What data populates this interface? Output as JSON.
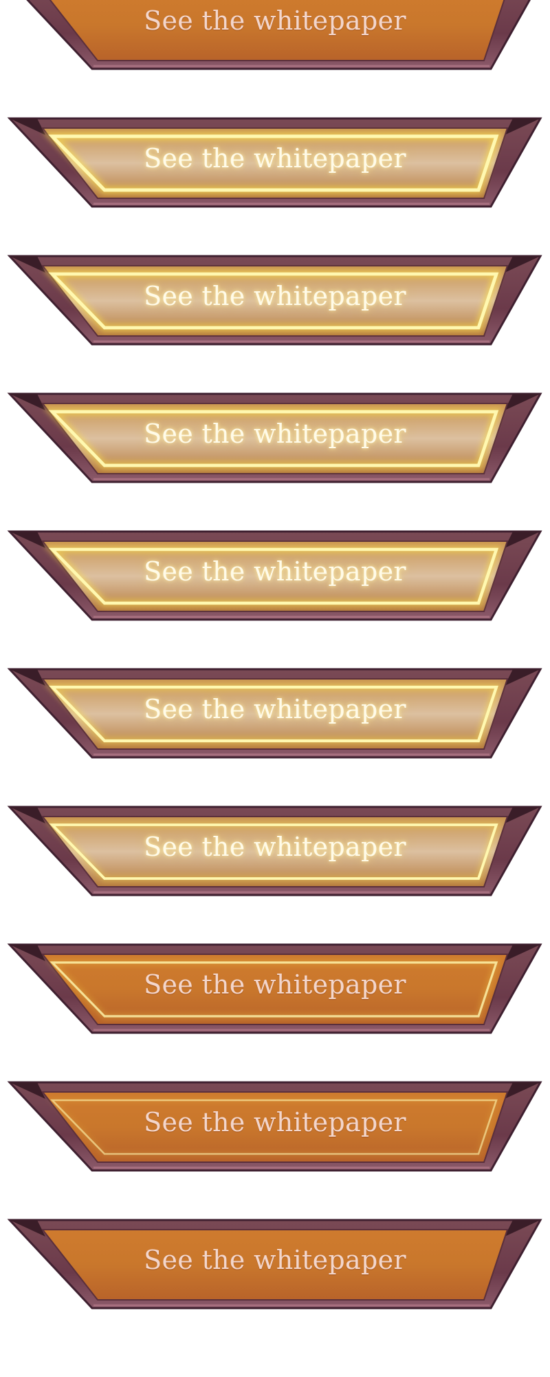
{
  "button_label": "See the whitepaper",
  "frames": [
    {
      "state": "idle",
      "glow_level": 0
    },
    {
      "state": "hover",
      "glow_level": 1
    },
    {
      "state": "hover",
      "glow_level": 0.95
    },
    {
      "state": "hover",
      "glow_level": 0.9
    },
    {
      "state": "hover",
      "glow_level": 0.85
    },
    {
      "state": "hover",
      "glow_level": 0.75
    },
    {
      "state": "hover",
      "glow_level": 0.6
    },
    {
      "state": "hover",
      "glow_level": 0.4
    },
    {
      "state": "hover",
      "glow_level": 0.2
    },
    {
      "state": "idle",
      "glow_level": 0
    }
  ],
  "colors": {
    "frame_outer": "#6b3a4a",
    "frame_dark": "#3f2030",
    "panel_orange": "#c9772c",
    "panel_deep": "#a85a22",
    "glow_yellow": "#ffe34a",
    "glow_core": "#fff8b0",
    "text": "#f6e1d6"
  }
}
